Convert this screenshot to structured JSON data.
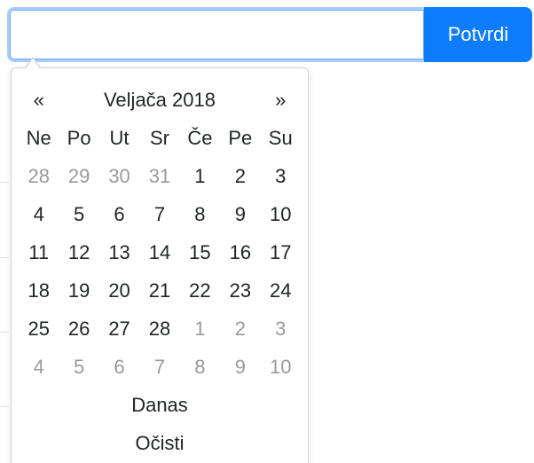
{
  "input": {
    "value": "",
    "placeholder": ""
  },
  "submit_button": {
    "label": "Potvrdi"
  },
  "datepicker": {
    "prev_label": "«",
    "next_label": "»",
    "month_title": "Veljača 2018",
    "weekdays": [
      "Ne",
      "Po",
      "Ut",
      "Sr",
      "Če",
      "Pe",
      "Su"
    ],
    "weeks": [
      [
        {
          "d": "28",
          "muted": true
        },
        {
          "d": "29",
          "muted": true
        },
        {
          "d": "30",
          "muted": true
        },
        {
          "d": "31",
          "muted": true
        },
        {
          "d": "1",
          "muted": false
        },
        {
          "d": "2",
          "muted": false
        },
        {
          "d": "3",
          "muted": false
        }
      ],
      [
        {
          "d": "4",
          "muted": false
        },
        {
          "d": "5",
          "muted": false
        },
        {
          "d": "6",
          "muted": false
        },
        {
          "d": "7",
          "muted": false
        },
        {
          "d": "8",
          "muted": false
        },
        {
          "d": "9",
          "muted": false
        },
        {
          "d": "10",
          "muted": false
        }
      ],
      [
        {
          "d": "11",
          "muted": false
        },
        {
          "d": "12",
          "muted": false
        },
        {
          "d": "13",
          "muted": false
        },
        {
          "d": "14",
          "muted": false
        },
        {
          "d": "15",
          "muted": false
        },
        {
          "d": "16",
          "muted": false
        },
        {
          "d": "17",
          "muted": false
        }
      ],
      [
        {
          "d": "18",
          "muted": false
        },
        {
          "d": "19",
          "muted": false
        },
        {
          "d": "20",
          "muted": false
        },
        {
          "d": "21",
          "muted": false
        },
        {
          "d": "22",
          "muted": false
        },
        {
          "d": "23",
          "muted": false
        },
        {
          "d": "24",
          "muted": false
        }
      ],
      [
        {
          "d": "25",
          "muted": false
        },
        {
          "d": "26",
          "muted": false
        },
        {
          "d": "27",
          "muted": false
        },
        {
          "d": "28",
          "muted": false
        },
        {
          "d": "1",
          "muted": true
        },
        {
          "d": "2",
          "muted": true
        },
        {
          "d": "3",
          "muted": true
        }
      ],
      [
        {
          "d": "4",
          "muted": true
        },
        {
          "d": "5",
          "muted": true
        },
        {
          "d": "6",
          "muted": true
        },
        {
          "d": "7",
          "muted": true
        },
        {
          "d": "8",
          "muted": true
        },
        {
          "d": "9",
          "muted": true
        },
        {
          "d": "10",
          "muted": true
        }
      ]
    ],
    "today_label": "Danas",
    "clear_label": "Očisti"
  },
  "colors": {
    "accent": "#0d7dfd",
    "muted_text": "#9a9a9a"
  }
}
